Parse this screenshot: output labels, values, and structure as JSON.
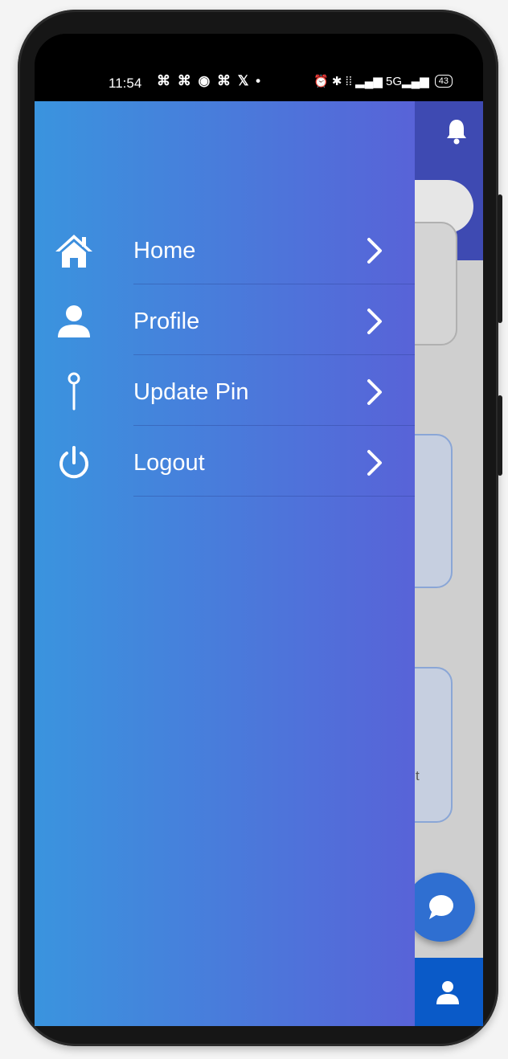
{
  "status_bar": {
    "time": "11:54",
    "notification_icons": "⌘ ⌘ ◉ ⌘ 𝕏 •",
    "right_icons": "⏰ ✱ ⁞⁞ ▂▄▆ 5G▂▄▆",
    "battery": "43"
  },
  "drawer": {
    "items": [
      {
        "label": "Home",
        "icon": "home-icon"
      },
      {
        "label": "Profile",
        "icon": "user-icon"
      },
      {
        "label": "Update Pin",
        "icon": "pin-icon"
      },
      {
        "label": "Logout",
        "icon": "power-icon"
      }
    ],
    "gradient_start": "#3a94de",
    "gradient_end": "#5863d8"
  },
  "background_app": {
    "header_color": "#3e4ab2",
    "card_text_fragment": "t",
    "fab_color": "#2f6fd1",
    "bottom_bar_color": "#0a5ac8"
  }
}
